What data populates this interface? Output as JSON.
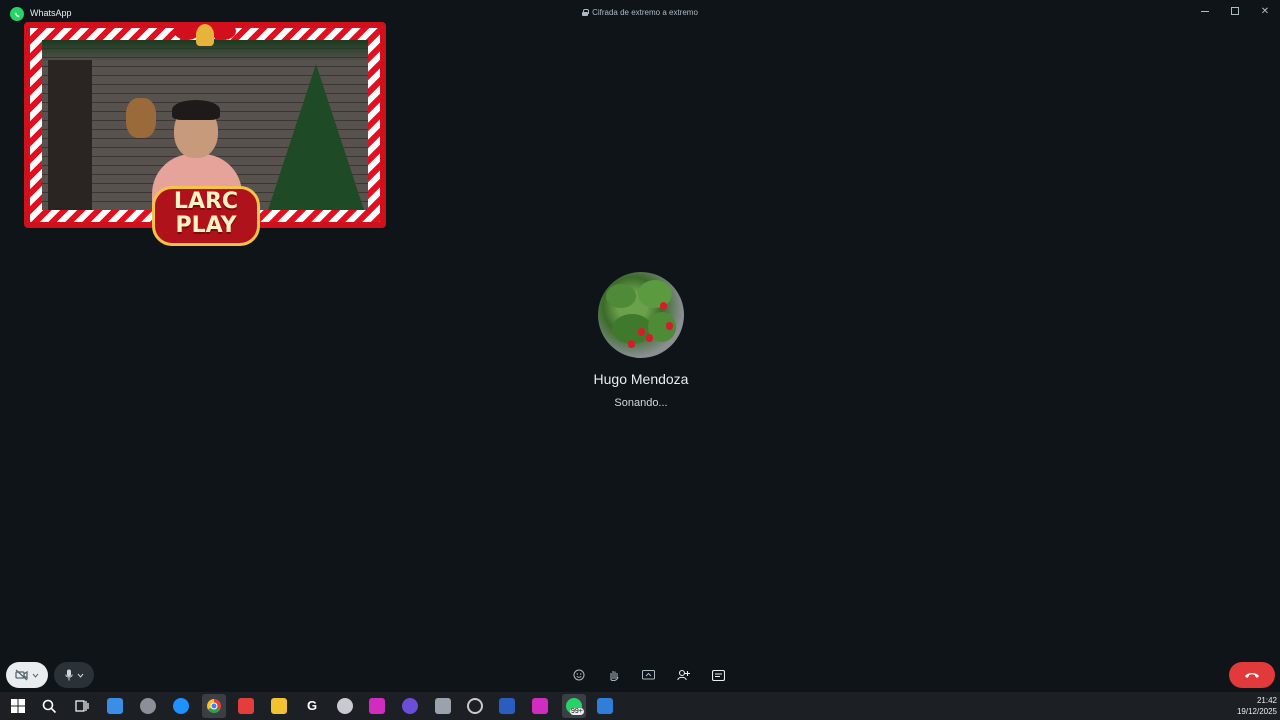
{
  "window": {
    "app_name": "WhatsApp",
    "encryption_notice": "Cifrada de extremo a extremo"
  },
  "self_view": {
    "overlay_text_line1": "LARC",
    "overlay_text_line2": "PLAY"
  },
  "callee": {
    "name": "Hugo Mendoza",
    "status": "Sonando..."
  },
  "call_controls": {
    "camera_state": "off",
    "microphone_state": "on",
    "tools": [
      "emoji-icon",
      "raise-hand-icon",
      "screen-share-icon",
      "add-participant-icon",
      "chat-icon"
    ],
    "end_call_color": "#e23a3a"
  },
  "taskbar": {
    "time": "21:42",
    "date": "19/12/2025",
    "whatsapp_badge": "99+"
  },
  "colors": {
    "background": "#0f1419",
    "whatsapp_green": "#25d366"
  }
}
